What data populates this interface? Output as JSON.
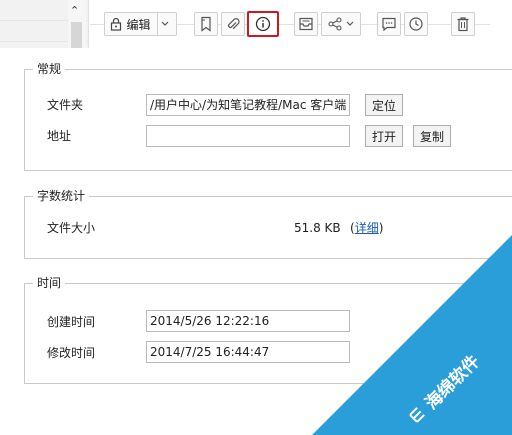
{
  "toolbar": {
    "edit_label": "编辑",
    "icons": [
      "lock-icon",
      "chevron-down-icon",
      "bookmark-icon",
      "paperclip-icon",
      "info-icon",
      "inbox-icon",
      "share-icon",
      "chevron-down-icon",
      "comment-icon",
      "clock-icon",
      "trash-icon"
    ],
    "active_icon": "info-icon",
    "active_border_color": "#d0181e"
  },
  "general": {
    "legend": "常规",
    "folder_label": "文件夹",
    "folder_value": "/用户中心/为知笔记教程/Mac 客户端",
    "locate_button": "定位",
    "address_label": "地址",
    "address_value": "",
    "open_button": "打开",
    "copy_button": "复制"
  },
  "stats": {
    "legend": "字数统计",
    "size_label": "文件大小",
    "size_value": "51.8 KB",
    "details_open": "(",
    "details_link": "详细",
    "details_close": ")"
  },
  "time": {
    "legend": "时间",
    "created_label": "创建时间",
    "created_value": "2014/5/26 12:22:16",
    "modified_label": "修改时间",
    "modified_value": "2014/7/25 16:44:47"
  },
  "watermark": {
    "text": "海绵软件",
    "color": "#2a9ed9"
  }
}
